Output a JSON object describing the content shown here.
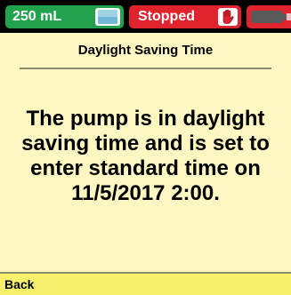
{
  "status_bar": {
    "volume": "250 mL",
    "status": "Stopped",
    "icons": {
      "bag": "iv-bag-icon",
      "hand": "hand-stop-icon",
      "battery": "battery-icon"
    },
    "colors": {
      "volume_badge": "#23A24D",
      "status_badge": "#E0242E",
      "background": "#000000"
    }
  },
  "main": {
    "title": "Daylight Saving Time",
    "message": "The pump is in daylight saving time and is set to enter standard time on 11/5/2017 2:00.",
    "background": "#FFF7C2"
  },
  "footer": {
    "back_label": "Back",
    "background": "#F7F06A"
  }
}
